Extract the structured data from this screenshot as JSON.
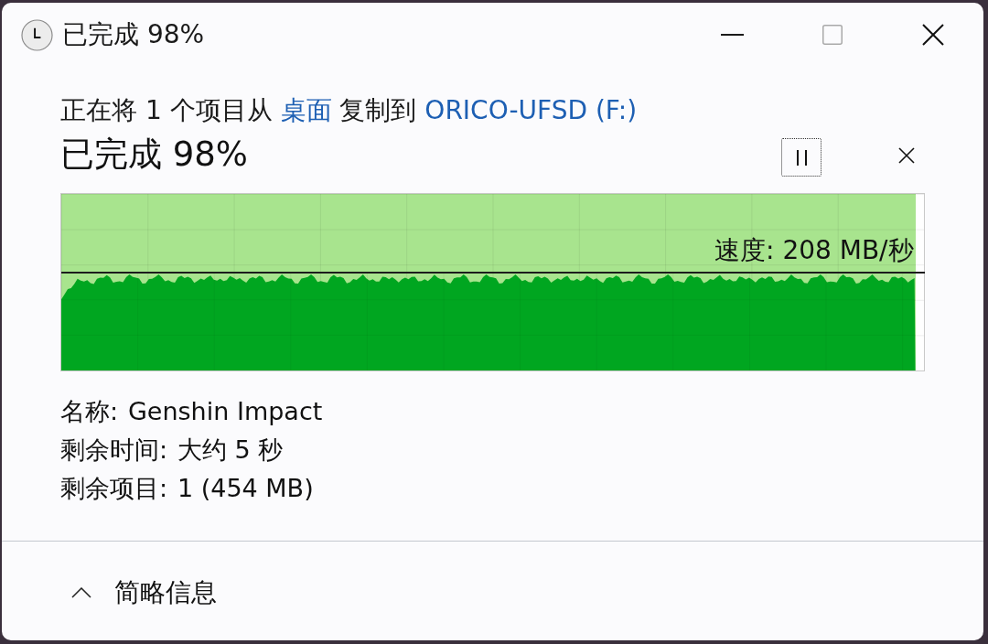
{
  "window": {
    "title": "已完成 98%",
    "maximize_disabled": true
  },
  "description": [
    {
      "kind": "text",
      "text": "正在将 1 个项目从"
    },
    {
      "kind": "link",
      "text": "桌面"
    },
    {
      "kind": "text",
      "text": "复制到"
    },
    {
      "kind": "link",
      "text": "ORICO-UFSD (F:)"
    }
  ],
  "progress": {
    "heading": "已完成 98%",
    "level": 0.99
  },
  "pause_button": {
    "focused": true
  },
  "graph": {
    "speed": "速度: 208 MB/秒"
  },
  "details": [
    {
      "label": "名称:",
      "value": "Genshin Impact"
    },
    {
      "label": "剩余时间:",
      "value": "大约 5 秒"
    },
    {
      "label": "剩余项目:",
      "value": "1 (454 MB)"
    }
  ],
  "footer": {
    "toggle": "简略信息",
    "expanded": true
  }
}
